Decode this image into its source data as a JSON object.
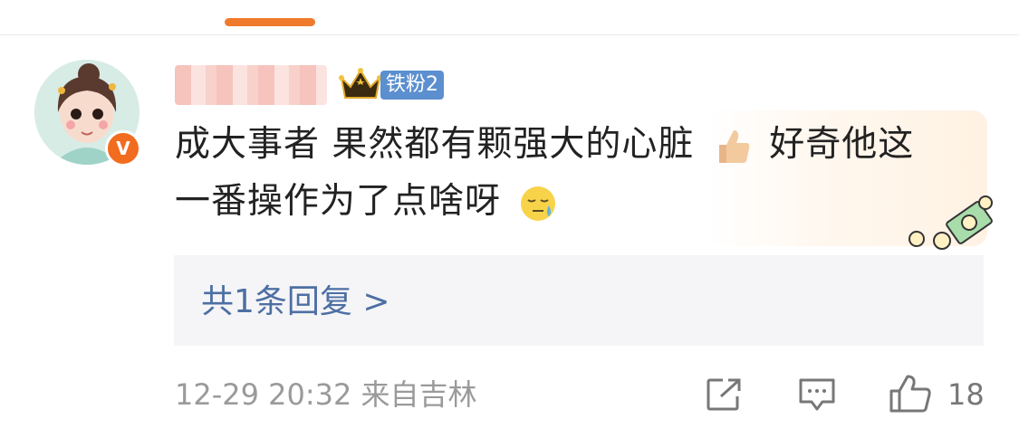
{
  "comment": {
    "username": "",
    "fan_badge": "铁粉2",
    "text_line1": "成大事者 果然都有颗强大的心脏",
    "text_mid": "好奇他这",
    "text_line2": "一番操作为了点啥呀",
    "emoji_1": "thumbs-up-icon",
    "emoji_2": "sweat-face-icon",
    "verified_badge": "V"
  },
  "reply": {
    "label": "共1条回复 >"
  },
  "footer": {
    "timestamp": "12-29 20:32",
    "location": "来自吉林",
    "like_count": "18"
  },
  "colors": {
    "accent": "#f07a2c",
    "link": "#4d6fa3",
    "badge_blue": "#5b8fcf",
    "meta_gray": "#9a9a9a"
  }
}
